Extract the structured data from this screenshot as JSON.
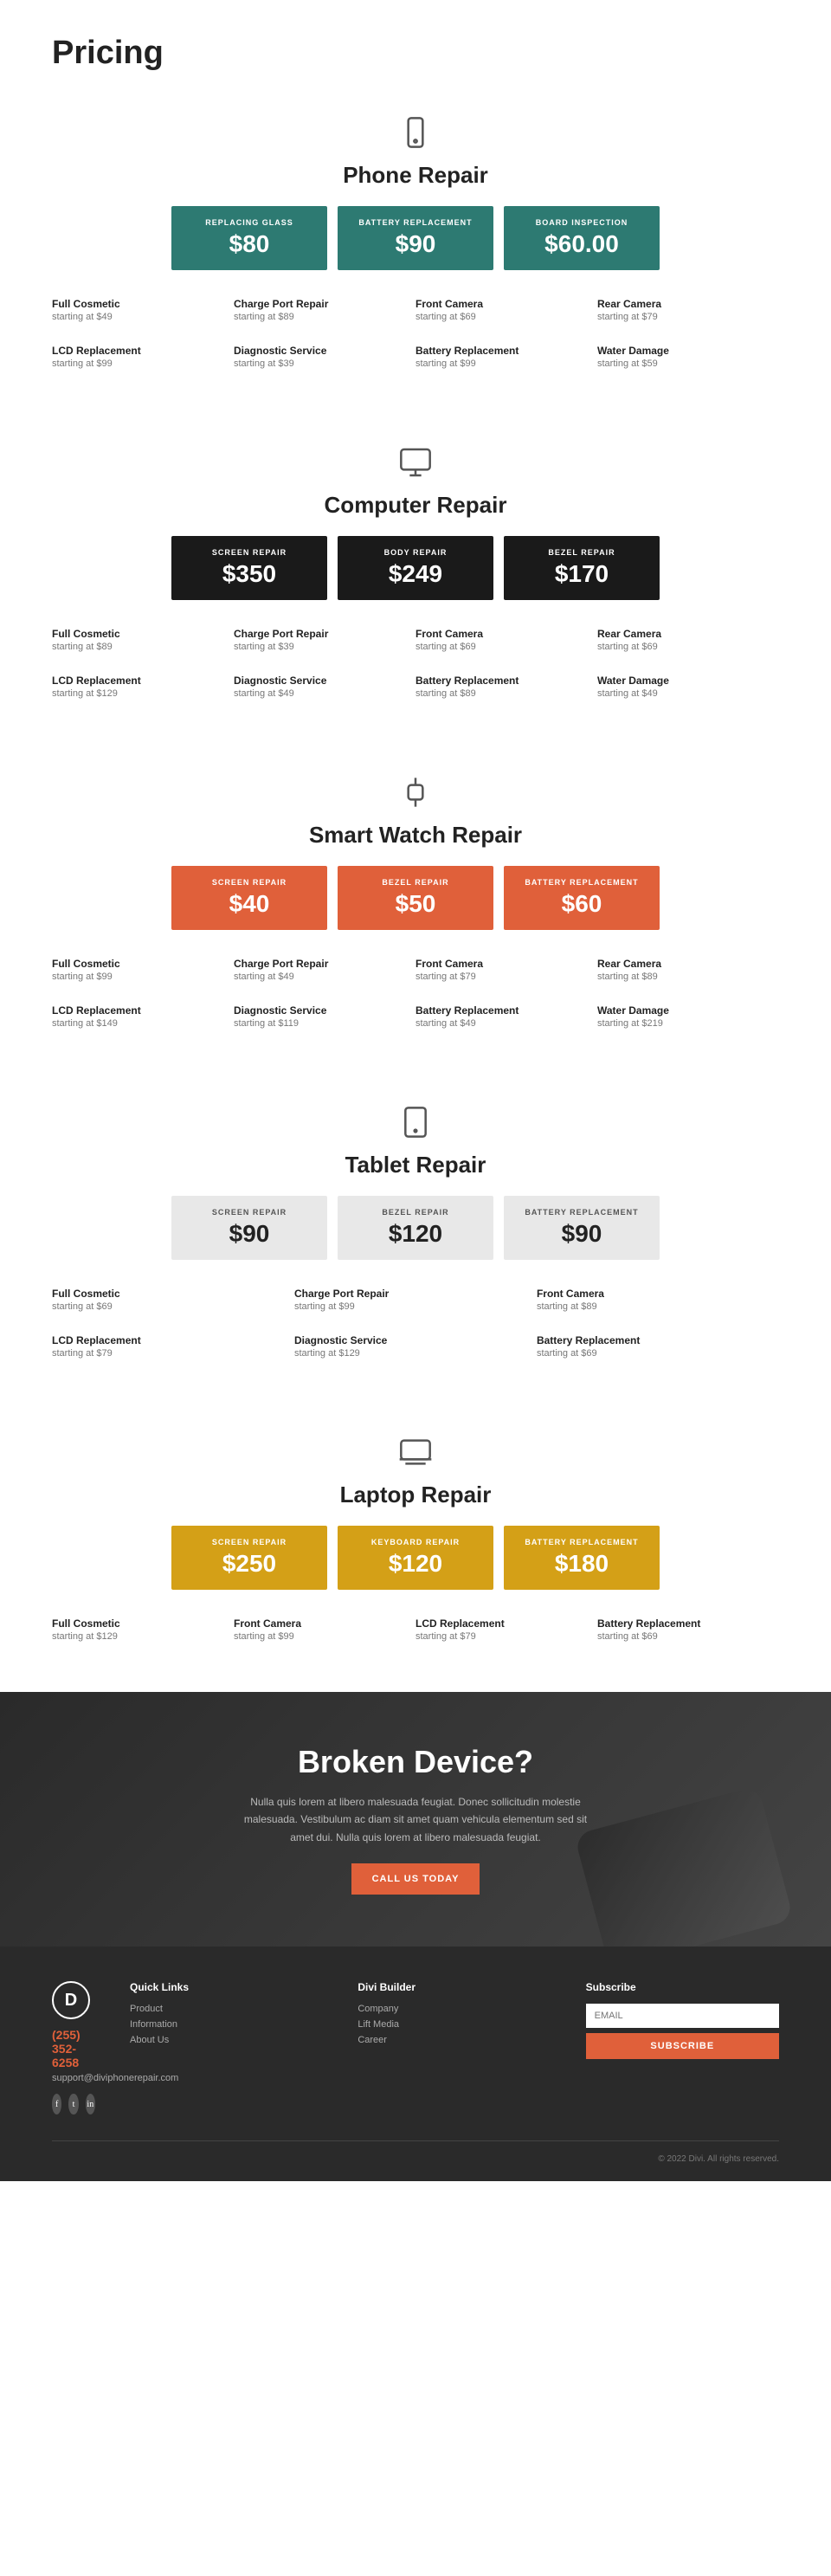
{
  "page": {
    "title": "Pricing"
  },
  "sections": [
    {
      "id": "phone",
      "title": "Phone Repair",
      "icon": "phone",
      "cards": [
        {
          "label": "Replacing Glass",
          "price": "$80",
          "theme": "teal"
        },
        {
          "label": "Battery Replacement",
          "price": "$90",
          "theme": "teal"
        },
        {
          "label": "Board Inspection",
          "price": "$60.00",
          "theme": "teal"
        }
      ],
      "services_row1": [
        {
          "name": "Full Cosmetic",
          "price": "starting at $49"
        },
        {
          "name": "Charge Port Repair",
          "price": "starting at $89"
        },
        {
          "name": "Front Camera",
          "price": "starting at $69"
        },
        {
          "name": "Rear Camera",
          "price": "starting at $79"
        }
      ],
      "services_row2": [
        {
          "name": "LCD Replacement",
          "price": "starting at $99"
        },
        {
          "name": "Diagnostic Service",
          "price": "starting at $39"
        },
        {
          "name": "Battery Replacement",
          "price": "starting at $99"
        },
        {
          "name": "Water Damage",
          "price": "starting at $59"
        }
      ]
    },
    {
      "id": "computer",
      "title": "Computer Repair",
      "icon": "computer",
      "cards": [
        {
          "label": "Screen Repair",
          "price": "$350",
          "theme": "black"
        },
        {
          "label": "Body Repair",
          "price": "$249",
          "theme": "black"
        },
        {
          "label": "Bezel Repair",
          "price": "$170",
          "theme": "black"
        }
      ],
      "services_row1": [
        {
          "name": "Full Cosmetic",
          "price": "starting at $89"
        },
        {
          "name": "Charge Port Repair",
          "price": "starting at $39"
        },
        {
          "name": "Front Camera",
          "price": "starting at $69"
        },
        {
          "name": "Rear Camera",
          "price": "starting at $69"
        }
      ],
      "services_row2": [
        {
          "name": "LCD Replacement",
          "price": "starting at $129"
        },
        {
          "name": "Diagnostic Service",
          "price": "starting at $49"
        },
        {
          "name": "Battery Replacement",
          "price": "starting at $89"
        },
        {
          "name": "Water Damage",
          "price": "starting at $49"
        }
      ]
    },
    {
      "id": "smartwatch",
      "title": "Smart Watch Repair",
      "icon": "watch",
      "cards": [
        {
          "label": "Screen Repair",
          "price": "$40",
          "theme": "orange"
        },
        {
          "label": "Bezel Repair",
          "price": "$50",
          "theme": "orange"
        },
        {
          "label": "Battery Replacement",
          "price": "$60",
          "theme": "orange"
        }
      ],
      "services_row1": [
        {
          "name": "Full Cosmetic",
          "price": "starting at $99"
        },
        {
          "name": "Charge Port Repair",
          "price": "starting at $49"
        },
        {
          "name": "Front Camera",
          "price": "starting at $79"
        },
        {
          "name": "Rear Camera",
          "price": "starting at $89"
        }
      ],
      "services_row2": [
        {
          "name": "LCD Replacement",
          "price": "starting at $149"
        },
        {
          "name": "Diagnostic Service",
          "price": "starting at $119"
        },
        {
          "name": "Battery Replacement",
          "price": "starting at $49"
        },
        {
          "name": "Water Damage",
          "price": "starting at $219"
        }
      ]
    },
    {
      "id": "tablet",
      "title": "Tablet Repair",
      "icon": "tablet",
      "cards": [
        {
          "label": "Screen Repair",
          "price": "$90",
          "theme": "gray"
        },
        {
          "label": "Bezel Repair",
          "price": "$120",
          "theme": "gray"
        },
        {
          "label": "Battery Replacement",
          "price": "$90",
          "theme": "gray"
        }
      ],
      "services_row1": [
        {
          "name": "Full Cosmetic",
          "price": "starting at $69"
        },
        {
          "name": "Charge Port Repair",
          "price": "starting at $99"
        },
        {
          "name": "Front Camera",
          "price": "starting at $89"
        },
        {
          "name": "",
          "price": ""
        }
      ],
      "services_row2": [
        {
          "name": "LCD Replacement",
          "price": "starting at $79"
        },
        {
          "name": "Diagnostic Service",
          "price": "starting at $129"
        },
        {
          "name": "Battery Replacement",
          "price": "starting at $69"
        },
        {
          "name": "",
          "price": ""
        }
      ],
      "cols": 3
    },
    {
      "id": "laptop",
      "title": "Laptop Repair",
      "icon": "laptop",
      "cards": [
        {
          "label": "Screen Repair",
          "price": "$250",
          "theme": "gold"
        },
        {
          "label": "Keyboard Repair",
          "price": "$120",
          "theme": "gold"
        },
        {
          "label": "Battery Replacement",
          "price": "$180",
          "theme": "gold"
        }
      ],
      "services_row1": [
        {
          "name": "Full Cosmetic",
          "price": "starting at $129"
        },
        {
          "name": "Front Camera",
          "price": "starting at $99"
        },
        {
          "name": "LCD Replacement",
          "price": "starting at $79"
        },
        {
          "name": "Battery Replacement",
          "price": "starting at $69"
        }
      ],
      "services_row2": []
    }
  ],
  "cta": {
    "title": "Broken Device?",
    "text": "Nulla quis lorem at libero malesuada feugiat. Donec sollicitudin molestie malesuada. Vestibulum ac diam sit amet quam vehicula elementum sed sit amet dui. Nulla quis lorem at libero malesuada feugiat.",
    "button_label": "CALL US TODAY"
  },
  "footer": {
    "logo_letter": "D",
    "phone": "(255) 352-6258",
    "email": "support@diviphonerepair.com",
    "quick_links": {
      "title": "Quick Links",
      "items": [
        "Product",
        "Information",
        "About Us"
      ]
    },
    "divi_builder": {
      "title": "Divi Builder",
      "items": [
        "Company",
        "Lift Media",
        "Career"
      ]
    },
    "subscribe": {
      "title": "Subscribe",
      "placeholder": "EMAIL",
      "button_label": "SUBSCRIBE"
    },
    "copyright": "© 2022 Divi. All rights reserved."
  }
}
